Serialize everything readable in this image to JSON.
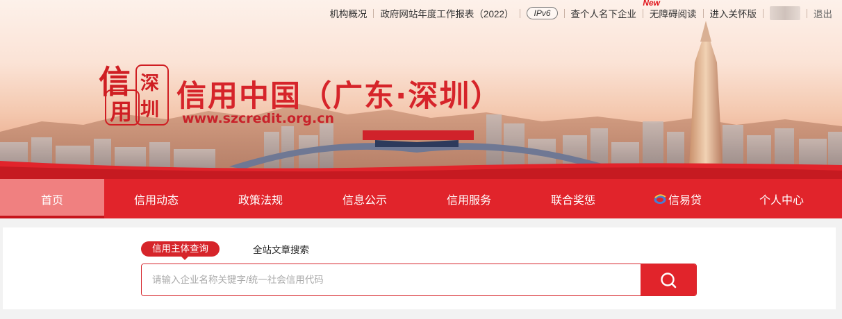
{
  "topbar": {
    "links": [
      "机构概况",
      "政府网站年度工作报表（2022）"
    ],
    "ipv6": "IPv6",
    "personal_search": "查个人名下企业",
    "new_tag": "New",
    "accessibility": "无障碍阅读",
    "care_mode": "进入关怀版",
    "logout": "退出"
  },
  "logo": {
    "seal_chars": [
      "信",
      "深",
      "用",
      "圳"
    ],
    "title": "信用中国（广东·深圳）",
    "url": "www.szcredit.org.cn"
  },
  "nav": {
    "items": [
      "首页",
      "信用动态",
      "政策法规",
      "信息公示",
      "信用服务",
      "联合奖惩",
      "信易贷",
      "个人中心"
    ],
    "active_index": 0
  },
  "search": {
    "tabs": [
      "信用主体查询",
      "全站文章搜索"
    ],
    "active_tab": 0,
    "placeholder": "请输入企业名称关键字/统一社会信用代码",
    "value": ""
  },
  "colors": {
    "brand_red": "#e1242b",
    "active_nav": "#f08080",
    "title_red": "#d6242a"
  }
}
